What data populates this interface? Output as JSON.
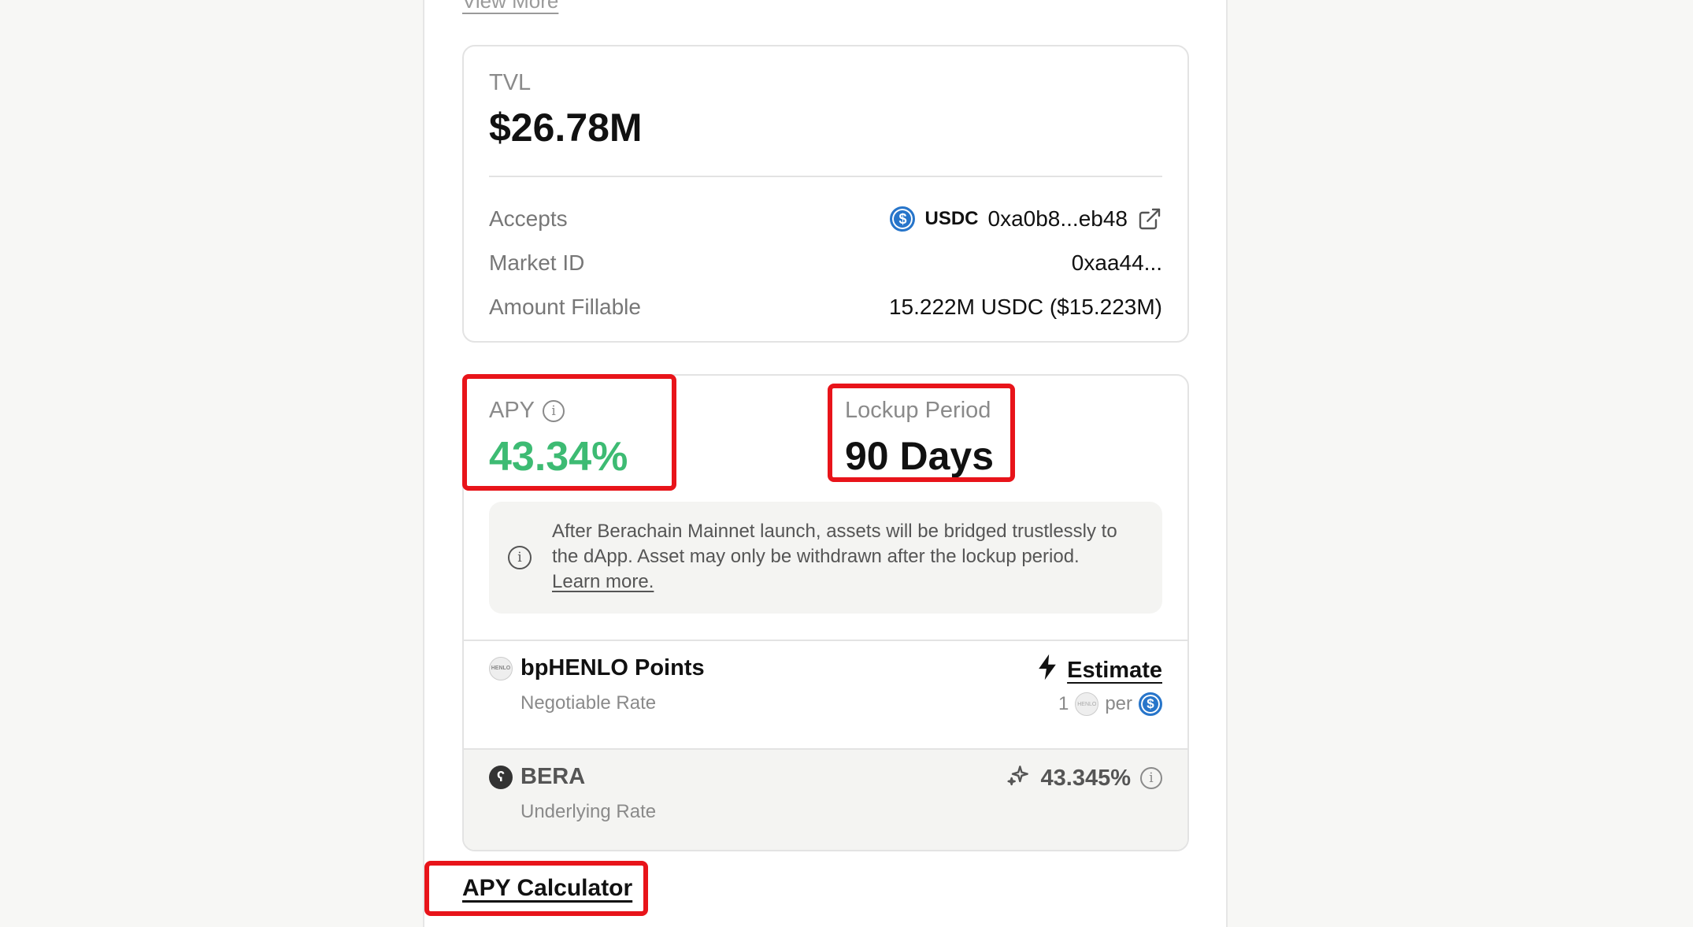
{
  "view_more": "View More",
  "tvl": {
    "label": "TVL",
    "value": "$26.78M"
  },
  "details": {
    "accepts_label": "Accepts",
    "accepts_token": "USDC",
    "accepts_address": "0xa0b8...eb48",
    "market_id_label": "Market ID",
    "market_id_value": "0xaa44...",
    "amount_fillable_label": "Amount Fillable",
    "amount_fillable_value": "15.222M USDC ($15.223M)"
  },
  "apy": {
    "label": "APY",
    "value": "43.34%",
    "color": "#3dbb73"
  },
  "lockup": {
    "label": "Lockup Period",
    "value": "90 Days"
  },
  "notice": {
    "text": "After Berachain Mainnet launch, assets will be bridged trustlessly to the dApp. Asset may only be withdrawn after the lockup period.",
    "link": "Learn more."
  },
  "rewards": [
    {
      "name": "bpHENLO Points",
      "subtitle": "Negotiable Rate",
      "action": "Estimate",
      "rate_prefix": "1",
      "rate_per": "per",
      "logo_text": "HENLO"
    },
    {
      "name": "BERA",
      "subtitle": "Underlying Rate",
      "rate": "43.345%"
    }
  ],
  "apy_calculator": "APY Calculator",
  "highlight_color": "#e8141a"
}
